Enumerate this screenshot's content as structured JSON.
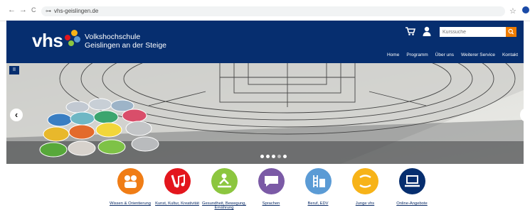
{
  "browser": {
    "url": "vhs-geislingen.de",
    "back": "←",
    "forward": "→",
    "reload": "C",
    "site_icon": "⊶",
    "bookmark": "☆"
  },
  "header": {
    "logo": "vhs",
    "brand_line1": "Volkshochschule",
    "brand_line2": "Geislingen an der Steige",
    "search_placeholder": "Kurssuche",
    "nav": [
      "Home",
      "Programm",
      "Über uns",
      "Weiterer Service",
      "Kontakt"
    ]
  },
  "hero": {
    "pause": "II",
    "prev": "‹",
    "next": "›",
    "slides": 5,
    "active_slide": 3
  },
  "categories": [
    {
      "label": "Wissen & Orientierung",
      "color": "#f07d16",
      "icon": "people-icon"
    },
    {
      "label": "Kunst, Kultur, Kreativität",
      "color": "#e3161d",
      "icon": "art-music-icon"
    },
    {
      "label": "Gesundheit, Bewegung, Ernährung",
      "color": "#8cc63f",
      "icon": "health-icon"
    },
    {
      "label": "Sprachen",
      "color": "#7b5aa6",
      "icon": "speech-icon"
    },
    {
      "label": "Beruf, EDV",
      "color": "#5b9bd5",
      "icon": "career-icon"
    },
    {
      "label": "Junge vhs",
      "color": "#f7b318",
      "icon": "junge-vhs-icon"
    },
    {
      "label": "Online-Angebote",
      "color": "#062e6f",
      "icon": "laptop-icon"
    }
  ]
}
